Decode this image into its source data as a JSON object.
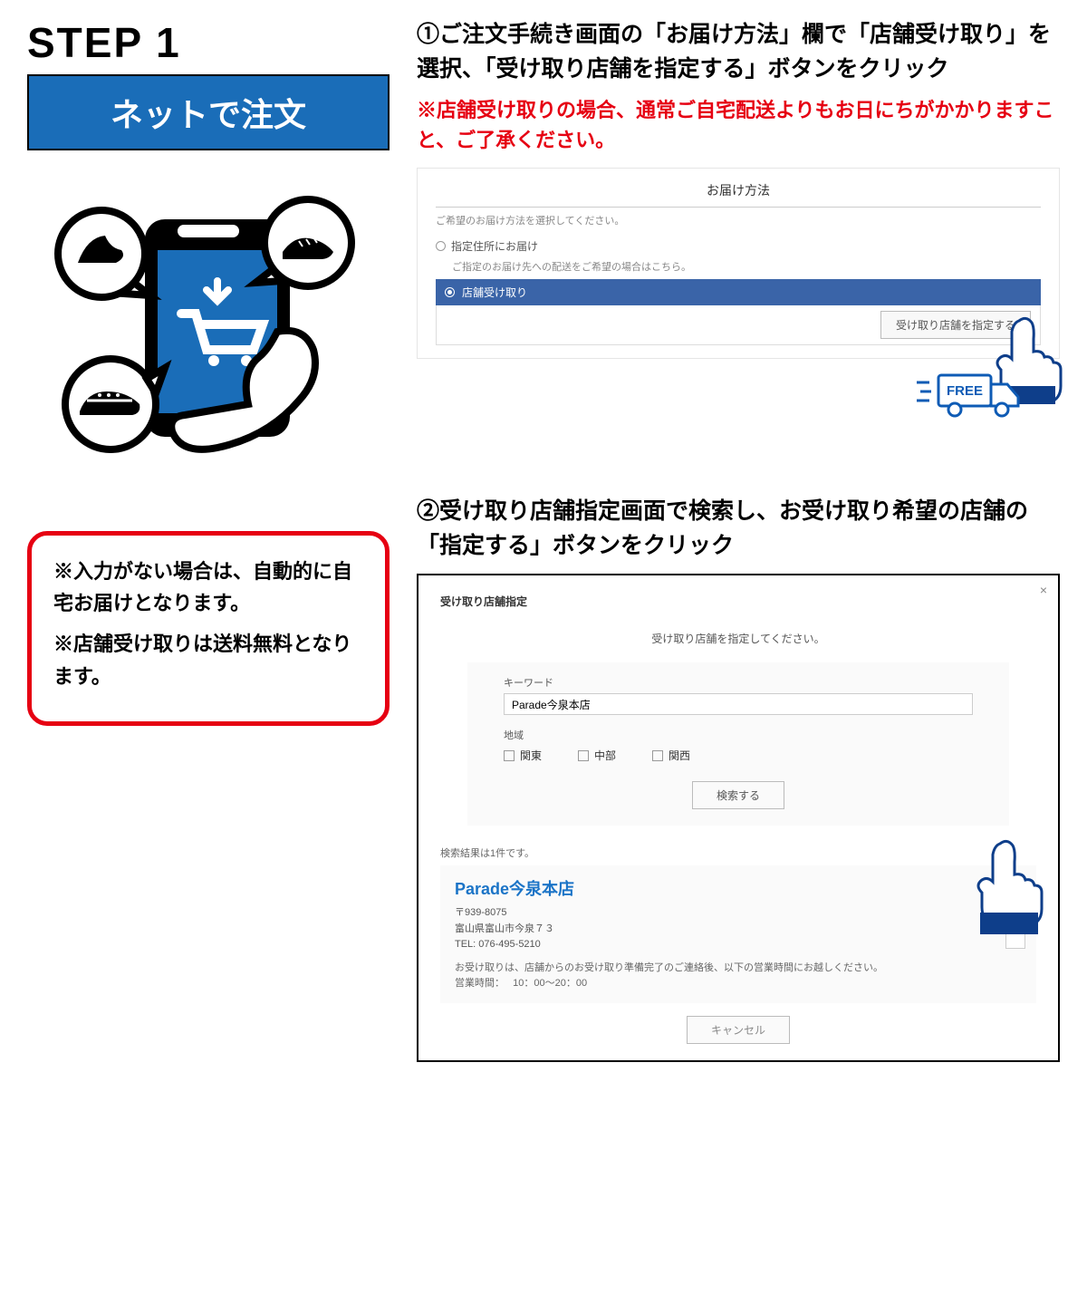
{
  "step": {
    "label": "STEP 1",
    "banner": "ネットで注文"
  },
  "instruction1": {
    "headline": "①ご注文手続き画面の「お届け方法」欄で「店舗受け取り」を選択、「受け取り店舗を指定する」ボタンをクリック",
    "notice": "※店舗受け取りの場合、通常ご自宅配送よりもお日にちがかかりますこと、ご了承ください。"
  },
  "delivery_panel": {
    "title": "お届け方法",
    "description": "ご希望のお届け方法を選択してください。",
    "option_home": "指定住所にお届け",
    "option_home_note": "ご指定のお届け先への配送をご希望の場合はこちら。",
    "option_store": "店舗受け取り",
    "specify_button": "受け取り店舗を指定する",
    "free_label": "FREE"
  },
  "red_notes": {
    "line1": "※入力がない場合は、自動的に自宅お届けとなります。",
    "line2": "※店舗受け取りは送料無料となります。"
  },
  "instruction2": {
    "headline": "②受け取り店舗指定画面で検索し、お受け取り希望の店舗の「指定する」ボタンをクリック"
  },
  "modal": {
    "title": "受け取り店舗指定",
    "prompt": "受け取り店舗を指定してください。",
    "keyword_label": "キーワード",
    "keyword_value": "Parade今泉本店",
    "region_label": "地域",
    "region_options": {
      "kanto": "関東",
      "chubu": "中部",
      "kansai": "関西"
    },
    "search_button": "検索する",
    "result_count": "検索結果は1件です。",
    "store": {
      "name": "Parade今泉本店",
      "zip": "〒939-8075",
      "address": "富山県富山市今泉７３",
      "tel": "TEL: 076-495-5210",
      "note": "お受け取りは、店舗からのお受け取り準備完了のご連絡後、以下の営業時間にお越しください。",
      "hours_label": "営業時間：",
      "hours_value": "10：00～20：00"
    },
    "cancel_button": "キャンセル"
  }
}
